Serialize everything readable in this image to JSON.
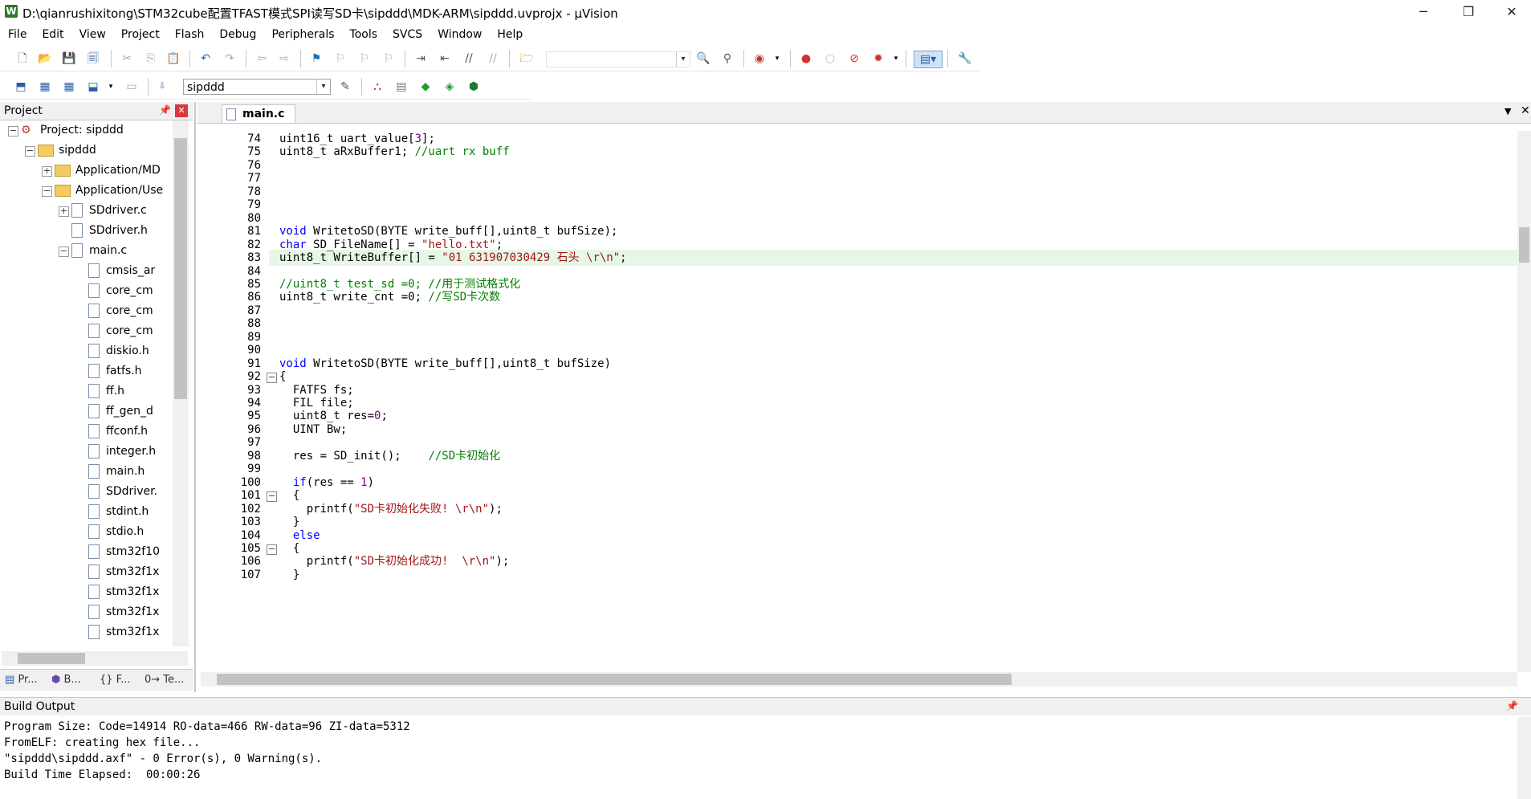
{
  "window": {
    "title": "D:\\qianrushixitong\\STM32cube配置TFAST模式SPI读写SD卡\\sipddd\\MDK-ARM\\sipddd.uvprojx - µVision",
    "app_icon": "W",
    "controls": {
      "minimize": "─",
      "restore": "❐",
      "close": "✕"
    }
  },
  "menu": [
    "File",
    "Edit",
    "View",
    "Project",
    "Flash",
    "Debug",
    "Peripherals",
    "Tools",
    "SVCS",
    "Window",
    "Help"
  ],
  "toolbar2": {
    "target_combo": "sipddd"
  },
  "project_pane": {
    "title": "Project",
    "tree": [
      {
        "label": "Project: sipddd",
        "level": 0,
        "expander": "−",
        "icon": "project"
      },
      {
        "label": "sipddd",
        "level": 1,
        "expander": "−",
        "icon": "folder"
      },
      {
        "label": "Application/MD",
        "level": 2,
        "expander": "+",
        "icon": "folder"
      },
      {
        "label": "Application/Use",
        "level": 2,
        "expander": "−",
        "icon": "folder"
      },
      {
        "label": "SDdriver.c",
        "level": 3,
        "expander": "+",
        "icon": "file"
      },
      {
        "label": "SDdriver.h",
        "level": 3,
        "expander": "",
        "icon": "file"
      },
      {
        "label": "main.c",
        "level": 3,
        "expander": "−",
        "icon": "file"
      },
      {
        "label": "cmsis_ar",
        "level": 4,
        "expander": "",
        "icon": "file"
      },
      {
        "label": "core_cm",
        "level": 4,
        "expander": "",
        "icon": "file"
      },
      {
        "label": "core_cm",
        "level": 4,
        "expander": "",
        "icon": "file"
      },
      {
        "label": "core_cm",
        "level": 4,
        "expander": "",
        "icon": "file"
      },
      {
        "label": "diskio.h",
        "level": 4,
        "expander": "",
        "icon": "file"
      },
      {
        "label": "fatfs.h",
        "level": 4,
        "expander": "",
        "icon": "file"
      },
      {
        "label": "ff.h",
        "level": 4,
        "expander": "",
        "icon": "file"
      },
      {
        "label": "ff_gen_d",
        "level": 4,
        "expander": "",
        "icon": "file"
      },
      {
        "label": "ffconf.h",
        "level": 4,
        "expander": "",
        "icon": "file"
      },
      {
        "label": "integer.h",
        "level": 4,
        "expander": "",
        "icon": "file"
      },
      {
        "label": "main.h",
        "level": 4,
        "expander": "",
        "icon": "file"
      },
      {
        "label": "SDdriver.",
        "level": 4,
        "expander": "",
        "icon": "file"
      },
      {
        "label": "stdint.h",
        "level": 4,
        "expander": "",
        "icon": "file"
      },
      {
        "label": "stdio.h",
        "level": 4,
        "expander": "",
        "icon": "file"
      },
      {
        "label": "stm32f10",
        "level": 4,
        "expander": "",
        "icon": "file"
      },
      {
        "label": "stm32f1x",
        "level": 4,
        "expander": "",
        "icon": "file"
      },
      {
        "label": "stm32f1x",
        "level": 4,
        "expander": "",
        "icon": "file"
      },
      {
        "label": "stm32f1x",
        "level": 4,
        "expander": "",
        "icon": "file"
      },
      {
        "label": "stm32f1x",
        "level": 4,
        "expander": "",
        "icon": "file"
      }
    ],
    "tabs": [
      "Pr...",
      "B...",
      "{} F...",
      "0→ Te..."
    ]
  },
  "editor": {
    "tab": "main.c",
    "highlighted_line": 83,
    "lines": [
      {
        "n": 74,
        "fold": "",
        "segs": [
          [
            "",
            "uint16_t uart_value["
          ],
          [
            "num",
            "3"
          ],
          [
            "",
            "];"
          ]
        ]
      },
      {
        "n": 75,
        "fold": "",
        "segs": [
          [
            "",
            "uint8_t aRxBuffer1; "
          ],
          [
            "cm",
            "//uart rx buff"
          ]
        ]
      },
      {
        "n": 76,
        "fold": "",
        "segs": []
      },
      {
        "n": 77,
        "fold": "",
        "segs": []
      },
      {
        "n": 78,
        "fold": "",
        "segs": []
      },
      {
        "n": 79,
        "fold": "",
        "segs": []
      },
      {
        "n": 80,
        "fold": "",
        "segs": []
      },
      {
        "n": 81,
        "fold": "",
        "segs": [
          [
            "kw",
            "void"
          ],
          [
            "",
            " WritetoSD(BYTE write_buff[],uint8_t bufSize);"
          ]
        ]
      },
      {
        "n": 82,
        "fold": "",
        "segs": [
          [
            "kw",
            "char"
          ],
          [
            "",
            " SD_FileName[] = "
          ],
          [
            "str",
            "\"hello.txt\""
          ],
          [
            "",
            ";"
          ]
        ]
      },
      {
        "n": 83,
        "fold": "",
        "segs": [
          [
            "",
            "uint8_t WriteBuffer[] = "
          ],
          [
            "str",
            "\"01 631907030429 石头 \\r\\n\""
          ],
          [
            "",
            ";"
          ]
        ]
      },
      {
        "n": 84,
        "fold": "",
        "segs": []
      },
      {
        "n": 85,
        "fold": "",
        "segs": [
          [
            "cm",
            "//uint8_t test_sd =0; //用于测试格式化"
          ]
        ]
      },
      {
        "n": 86,
        "fold": "",
        "segs": [
          [
            "",
            "uint8_t write_cnt =0; "
          ],
          [
            "cm",
            "//写SD卡次数"
          ]
        ]
      },
      {
        "n": 87,
        "fold": "",
        "segs": []
      },
      {
        "n": 88,
        "fold": "",
        "segs": []
      },
      {
        "n": 89,
        "fold": "",
        "segs": []
      },
      {
        "n": 90,
        "fold": "",
        "segs": []
      },
      {
        "n": 91,
        "fold": "",
        "segs": [
          [
            "kw",
            "void"
          ],
          [
            "",
            " WritetoSD(BYTE write_buff[],uint8_t bufSize)"
          ]
        ]
      },
      {
        "n": 92,
        "fold": "−",
        "segs": [
          [
            "",
            "{"
          ]
        ]
      },
      {
        "n": 93,
        "fold": "",
        "segs": [
          [
            "",
            "  FATFS fs;"
          ]
        ]
      },
      {
        "n": 94,
        "fold": "",
        "segs": [
          [
            "",
            "  FIL file;"
          ]
        ]
      },
      {
        "n": 95,
        "fold": "",
        "segs": [
          [
            "",
            "  uint8_t res="
          ],
          [
            "num",
            "0"
          ],
          [
            "",
            ";"
          ]
        ]
      },
      {
        "n": 96,
        "fold": "",
        "segs": [
          [
            "",
            "  UINT Bw;"
          ]
        ]
      },
      {
        "n": 97,
        "fold": "",
        "segs": []
      },
      {
        "n": 98,
        "fold": "",
        "segs": [
          [
            "",
            "  res = SD_init();    "
          ],
          [
            "cm",
            "//SD卡初始化"
          ]
        ]
      },
      {
        "n": 99,
        "fold": "",
        "segs": []
      },
      {
        "n": 100,
        "fold": "",
        "segs": [
          [
            "",
            "  "
          ],
          [
            "kw",
            "if"
          ],
          [
            "",
            "(res == "
          ],
          [
            "num",
            "1"
          ],
          [
            "",
            ")"
          ]
        ]
      },
      {
        "n": 101,
        "fold": "−",
        "segs": [
          [
            "",
            "  {"
          ]
        ]
      },
      {
        "n": 102,
        "fold": "",
        "segs": [
          [
            "",
            "    printf("
          ],
          [
            "str",
            "\"SD卡初始化失败! \\r\\n\""
          ],
          [
            "",
            ");"
          ]
        ]
      },
      {
        "n": 103,
        "fold": "",
        "segs": [
          [
            "",
            "  }"
          ]
        ]
      },
      {
        "n": 104,
        "fold": "",
        "segs": [
          [
            "",
            "  "
          ],
          [
            "kw",
            "else"
          ]
        ]
      },
      {
        "n": 105,
        "fold": "−",
        "segs": [
          [
            "",
            "  {"
          ]
        ]
      },
      {
        "n": 106,
        "fold": "",
        "segs": [
          [
            "",
            "    printf("
          ],
          [
            "str",
            "\"SD卡初始化成功!  \\r\\n\""
          ],
          [
            "",
            ");"
          ]
        ]
      },
      {
        "n": 107,
        "fold": "",
        "segs": [
          [
            "",
            "  }"
          ]
        ]
      }
    ]
  },
  "build_output": {
    "title": "Build Output",
    "lines": [
      "Program Size: Code=14914 RO-data=466 RW-data=96 ZI-data=5312",
      "FromELF: creating hex file...",
      "\"sipddd\\sipddd.axf\" - 0 Error(s), 0 Warning(s).",
      "Build Time Elapsed:  00:00:26"
    ]
  },
  "colors": {
    "keyword": "#0000ff",
    "string": "#a31515",
    "comment": "#008000",
    "number": "#800080",
    "current_line": "#e7f7e7"
  }
}
